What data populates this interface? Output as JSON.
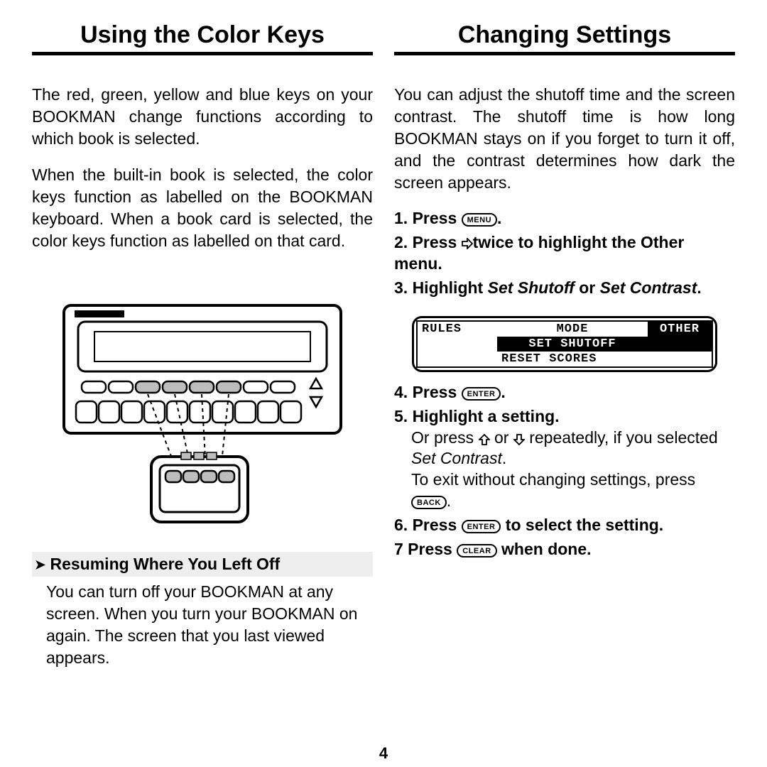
{
  "page_number": "4",
  "left": {
    "title": "Using the Color Keys",
    "p1": "The red, green, yellow and blue keys on your BOOKMAN change functions according to which book is selected.",
    "p2": "When the built-in book is selected, the color keys function as labelled on the BOOKMAN keyboard. When a book card is selected, the color keys function as labelled on that card.",
    "callout_title": "Resuming Where You Left Off",
    "callout_body": "You can turn off your BOOKMAN at any screen. When you turn your BOOKMAN on again. The screen that you last viewed appears."
  },
  "right": {
    "title": "Changing Settings",
    "intro": "You can adjust the shutoff time and the screen contrast. The shutoff time is how long BOOKMAN stays on if you forget to turn it off, and the contrast determines how dark the screen appears.",
    "steps": {
      "s1_a": "1. Press ",
      "s1_b": ".",
      "s2_a": "2. Press ",
      "s2_b": "twice to highlight the Other menu.",
      "s3_a": "3. Highlight ",
      "s3_b": "Set Shutoff",
      "s3_c": " or ",
      "s3_d": "Set Contrast",
      "s3_e": ".",
      "s4_a": "4. Press ",
      "s4_b": ".",
      "s5": "5. Highlight a setting.",
      "s5_body_a": "Or press ",
      "s5_body_b": " or ",
      "s5_body_c": " repeatedly, if you selected ",
      "s5_body_d": "Set Contrast",
      "s5_body_e": ".",
      "s5_body2_a": "To exit without changing settings, press ",
      "s5_body2_b": ".",
      "s6_a": "6. Press ",
      "s6_b": " to select the setting.",
      "s7_a": "7  Press ",
      "s7_b": " when done."
    },
    "buttons": {
      "menu": "MENU",
      "enter": "ENTER",
      "back": "BACK",
      "clear": "CLEAR"
    },
    "screen": {
      "r1_rules": "RULES",
      "r1_mode": "MODE",
      "r1_other": "OTHER",
      "r2": "SET SHUTOFF",
      "r3": "RESET SCORES"
    }
  }
}
